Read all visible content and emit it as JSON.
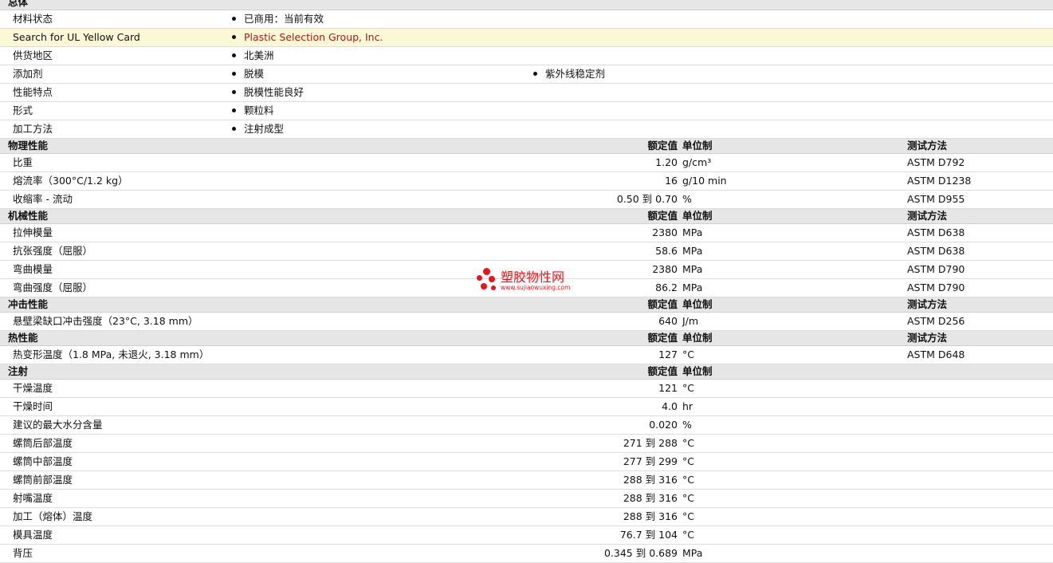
{
  "sections": {
    "general": {
      "title": "总体"
    },
    "physical": {
      "title": "物理性能",
      "col_value": "额定值",
      "col_unit": "单位制",
      "col_test": "测试方法"
    },
    "mechanical": {
      "title": "机械性能",
      "col_value": "额定值",
      "col_unit": "单位制",
      "col_test": "测试方法"
    },
    "impact": {
      "title": "冲击性能",
      "col_value": "额定值",
      "col_unit": "单位制",
      "col_test": "测试方法"
    },
    "thermal": {
      "title": "热性能",
      "col_value": "额定值",
      "col_unit": "单位制",
      "col_test": "测试方法"
    },
    "injection": {
      "title": "注射",
      "col_value": "额定值",
      "col_unit": "单位制"
    }
  },
  "general_rows": [
    {
      "label": "材料状态",
      "values": [
        "已商用：当前有效"
      ]
    },
    {
      "label": "Search for UL Yellow Card",
      "values": [
        "Plastic Selection Group, Inc."
      ]
    },
    {
      "label": "供货地区",
      "values": [
        "北美洲"
      ]
    },
    {
      "label": "添加剂",
      "values": [
        "脱模",
        "紫外线稳定剂"
      ]
    },
    {
      "label": "性能特点",
      "values": [
        "脱模性能良好"
      ]
    },
    {
      "label": "形式",
      "values": [
        "颗粒料"
      ]
    },
    {
      "label": "加工方法",
      "values": [
        "注射成型"
      ]
    }
  ],
  "physical_rows": [
    {
      "label": "比重",
      "value": "1.20",
      "unit": "g/cm³",
      "test": "ASTM D792"
    },
    {
      "label": "熔流率（300°C/1.2 kg）",
      "value": "16",
      "unit": "g/10 min",
      "test": "ASTM D1238"
    },
    {
      "label": "收缩率 - 流动",
      "value": "0.50 到  0.70",
      "unit": "%",
      "test": "ASTM D955"
    }
  ],
  "mechanical_rows": [
    {
      "label": "拉伸模量",
      "value": "2380",
      "unit": "MPa",
      "test": "ASTM D638"
    },
    {
      "label": "抗张强度（屈服）",
      "value": "58.6",
      "unit": "MPa",
      "test": "ASTM D638"
    },
    {
      "label": "弯曲模量",
      "value": "2380",
      "unit": "MPa",
      "test": "ASTM D790"
    },
    {
      "label": "弯曲强度（屈服）",
      "value": "86.2",
      "unit": "MPa",
      "test": "ASTM D790"
    }
  ],
  "impact_rows": [
    {
      "label": "悬壁梁缺口冲击强度（23°C, 3.18 mm）",
      "value": "640",
      "unit": "J/m",
      "test": "ASTM D256"
    }
  ],
  "thermal_rows": [
    {
      "label": "热变形温度（1.8 MPa, 未退火, 3.18 mm）",
      "value": "127",
      "unit": "°C",
      "test": "ASTM D648"
    }
  ],
  "injection_rows": [
    {
      "label": "干燥温度",
      "value": "121",
      "unit": "°C"
    },
    {
      "label": "干燥时间",
      "value": "4.0",
      "unit": "hr"
    },
    {
      "label": "建议的最大水分含量",
      "value": "0.020",
      "unit": "%"
    },
    {
      "label": "螺筒后部温度",
      "value": "271 到  288",
      "unit": "°C"
    },
    {
      "label": "螺筒中部温度",
      "value": "277 到  299",
      "unit": "°C"
    },
    {
      "label": "螺筒前部温度",
      "value": "288 到  316",
      "unit": "°C"
    },
    {
      "label": "射嘴温度",
      "value": "288 到  316",
      "unit": "°C"
    },
    {
      "label": "加工（熔体）温度",
      "value": "288 到  316",
      "unit": "°C"
    },
    {
      "label": "模具温度",
      "value": "76.7 到  104",
      "unit": "°C"
    },
    {
      "label": "背压",
      "value": "0.345 到  0.689",
      "unit": "MPa"
    }
  ],
  "watermark": {
    "title": "塑胶物性网",
    "url": "www.sujiaowuxing.com",
    "color": "#e8141c"
  },
  "colors": {
    "highlight_row": "#fbf8d5",
    "link": "#9b1b1b",
    "section_header": "#e6e6e6"
  }
}
